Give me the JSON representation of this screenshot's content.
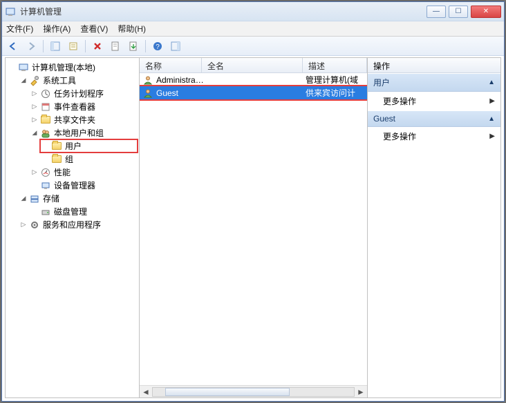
{
  "window": {
    "title": "计算机管理"
  },
  "menu": {
    "file": "文件(F)",
    "action": "操作(A)",
    "view": "查看(V)",
    "help": "帮助(H)"
  },
  "toolbar_icons": {
    "back": "back-icon",
    "forward": "forward-icon",
    "up": "up-icon",
    "properties": "properties-icon",
    "delete": "delete-icon",
    "new": "new-icon",
    "export": "export-icon",
    "help": "help-icon",
    "refresh": "refresh-icon"
  },
  "tree": {
    "root": "计算机管理(本地)",
    "system_tools": "系统工具",
    "task_scheduler": "任务计划程序",
    "event_viewer": "事件查看器",
    "shared_folders": "共享文件夹",
    "local_users_groups": "本地用户和组",
    "users": "用户",
    "groups": "组",
    "performance": "性能",
    "device_manager": "设备管理器",
    "storage": "存储",
    "disk_management": "磁盘管理",
    "services_apps": "服务和应用程序"
  },
  "list": {
    "columns": {
      "name": "名称",
      "fullname": "全名",
      "description": "描述"
    },
    "col_widths": {
      "name": 90,
      "fullname": 146,
      "description": 90
    },
    "rows": [
      {
        "name": "Administrat...",
        "fullname": "",
        "description": "管理计算机(域",
        "selected": false
      },
      {
        "name": "Guest",
        "fullname": "",
        "description": "供来宾访问计",
        "selected": true,
        "highlight": true
      }
    ]
  },
  "actions": {
    "header": "操作",
    "groups": [
      {
        "title": "用户",
        "items": [
          "更多操作"
        ]
      },
      {
        "title": "Guest",
        "items": [
          "更多操作"
        ]
      }
    ]
  }
}
